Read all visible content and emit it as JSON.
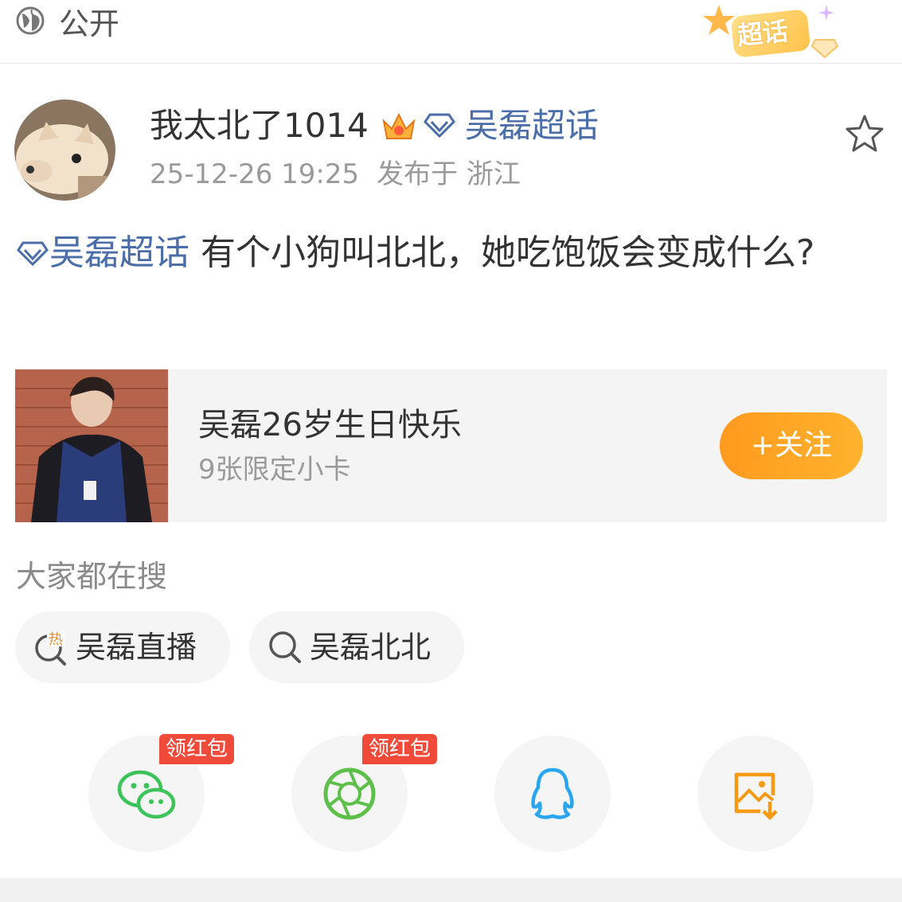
{
  "topbar": {
    "visibility_label": "公开",
    "badge_label": "超话"
  },
  "post": {
    "username": "我太北了1014",
    "topic_link": "吴磊超话",
    "time": "25-12-26 19:25",
    "source": "发布于 浙江",
    "body_tag": "吴磊超话",
    "body_text": " 有个小狗叫北北，她吃饱饭会变成什么?"
  },
  "card": {
    "title": "吴磊26岁生日快乐",
    "subtitle": "9张限定小卡",
    "follow_label": "+关注"
  },
  "search": {
    "title": "大家都在搜",
    "chips": [
      {
        "label": "吴磊直播",
        "icon": "hot-search-icon"
      },
      {
        "label": "吴磊北北",
        "icon": "search-icon"
      }
    ]
  },
  "share": {
    "redpack_label": "领红包",
    "items": [
      {
        "icon": "wechat-icon",
        "color": "#3cc35a"
      },
      {
        "icon": "moments-icon",
        "color": "#5ec04a"
      },
      {
        "icon": "qq-icon",
        "color": "#2aa6f0"
      },
      {
        "icon": "save-image-icon",
        "color": "#f59a12"
      }
    ]
  },
  "colors": {
    "accent": "#ff9a1f",
    "link": "#4b6ea8",
    "redpack": "#f04a3a"
  }
}
